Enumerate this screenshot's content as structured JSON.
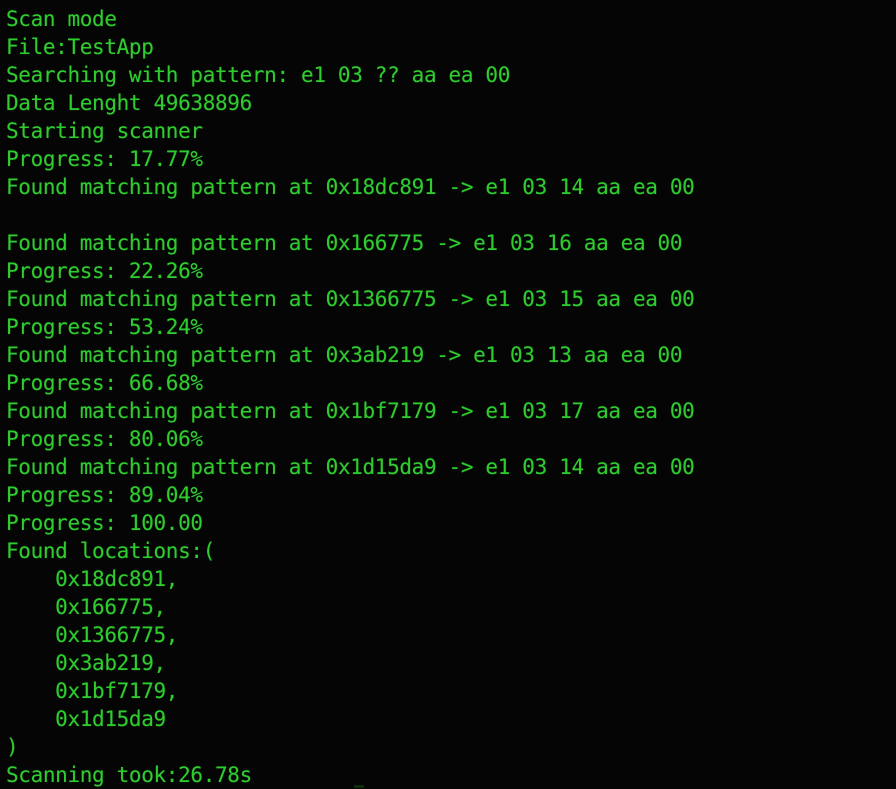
{
  "terminal": {
    "title": "Pattern scanner console output",
    "background_color": "#050505",
    "text_color": "#2fcc2f",
    "lines": [
      {
        "id": "scan-mode",
        "text": "Scan mode"
      },
      {
        "id": "file",
        "text": "File:TestApp"
      },
      {
        "id": "search-pattern",
        "text": "Searching with pattern: e1 03 ?? aa ea 00"
      },
      {
        "id": "data-length",
        "text": "Data Lenght 49638896"
      },
      {
        "id": "starting-scanner",
        "text": "Starting scanner"
      },
      {
        "id": "progress-1",
        "text": "Progress: 17.77%"
      },
      {
        "id": "match-1",
        "text": "Found matching pattern at 0x18dc891 -> e1 03 14 aa ea 00"
      },
      {
        "id": "blank-1",
        "text": ""
      },
      {
        "id": "match-2",
        "text": "Found matching pattern at 0x166775 -> e1 03 16 aa ea 00"
      },
      {
        "id": "progress-2",
        "text": "Progress: 22.26%"
      },
      {
        "id": "match-3",
        "text": "Found matching pattern at 0x1366775 -> e1 03 15 aa ea 00"
      },
      {
        "id": "progress-3",
        "text": "Progress: 53.24%"
      },
      {
        "id": "match-4",
        "text": "Found matching pattern at 0x3ab219 -> e1 03 13 aa ea 00"
      },
      {
        "id": "progress-4",
        "text": "Progress: 66.68%"
      },
      {
        "id": "match-5",
        "text": "Found matching pattern at 0x1bf7179 -> e1 03 17 aa ea 00"
      },
      {
        "id": "progress-5",
        "text": "Progress: 80.06%"
      },
      {
        "id": "match-6",
        "text": "Found matching pattern at 0x1d15da9 -> e1 03 14 aa ea 00"
      },
      {
        "id": "progress-6",
        "text": "Progress: 89.04%"
      },
      {
        "id": "progress-7",
        "text": "Progress: 100.00"
      },
      {
        "id": "found-locations",
        "text": "Found locations:("
      },
      {
        "id": "location-1",
        "text": "    0x18dc891,"
      },
      {
        "id": "location-2",
        "text": "    0x166775,"
      },
      {
        "id": "location-3",
        "text": "    0x1366775,"
      },
      {
        "id": "location-4",
        "text": "    0x3ab219,"
      },
      {
        "id": "location-5",
        "text": "    0x1bf7179,"
      },
      {
        "id": "location-6",
        "text": "    0x1d15da9"
      },
      {
        "id": "close-paren",
        "text": ")"
      },
      {
        "id": "scanning-took",
        "text": "Scanning took:26.78s"
      }
    ],
    "scan": {
      "mode": "Scan mode",
      "file": "TestApp",
      "pattern": "e1 03 ?? aa ea 00",
      "data_length": "49638896",
      "status": "Starting scanner",
      "elapsed": "26.78s",
      "progress_values": [
        "17.77%",
        "22.26%",
        "53.24%",
        "66.68%",
        "80.06%",
        "89.04%",
        "100.00"
      ],
      "matches": [
        {
          "address": "0x18dc891",
          "bytes": "e1 03 14 aa ea 00"
        },
        {
          "address": "0x166775",
          "bytes": "e1 03 16 aa ea 00"
        },
        {
          "address": "0x1366775",
          "bytes": "e1 03 15 aa ea 00"
        },
        {
          "address": "0x3ab219",
          "bytes": "e1 03 13 aa ea 00"
        },
        {
          "address": "0x1bf7179",
          "bytes": "e1 03 17 aa ea 00"
        },
        {
          "address": "0x1d15da9",
          "bytes": "e1 03 14 aa ea 00"
        }
      ],
      "found_locations": [
        "0x18dc891",
        "0x166775",
        "0x1366775",
        "0x3ab219",
        "0x1bf7179",
        "0x1d15da9"
      ]
    }
  }
}
